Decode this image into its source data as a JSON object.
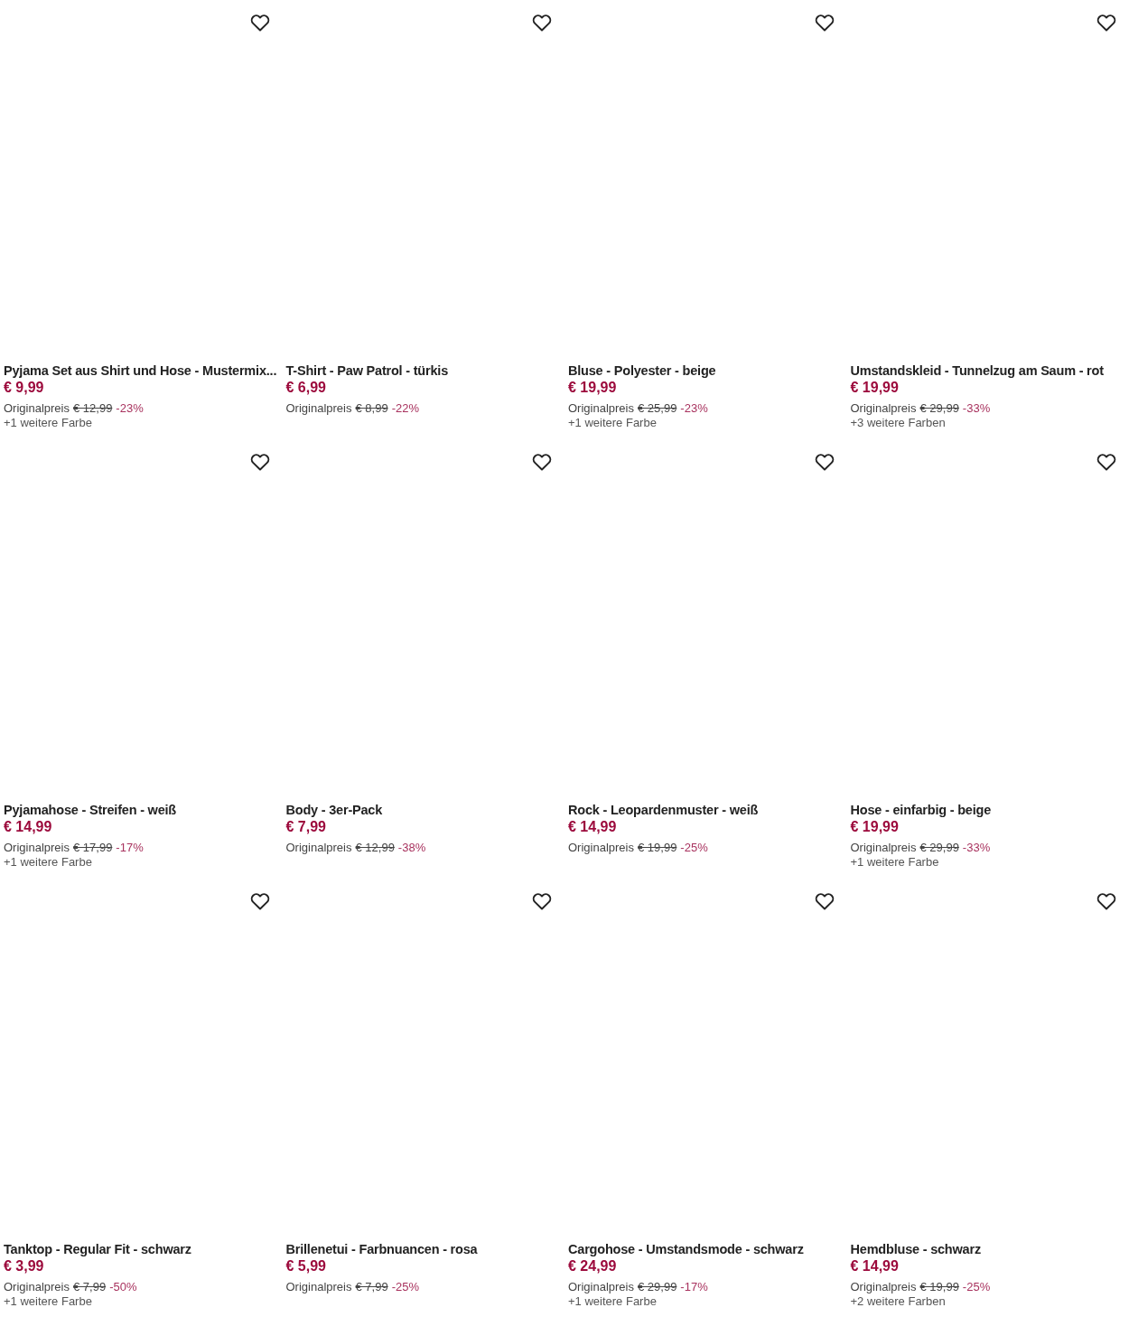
{
  "products": [
    {
      "name": "Pyjama Set aus Shirt und Hose - Mustermix...",
      "price": "€ 9,99",
      "original_label": "Originalpreis",
      "original_price": "€ 12,99",
      "discount": "-23%",
      "more_colors": "+1 weitere Farbe"
    },
    {
      "name": "T-Shirt - Paw Patrol - türkis",
      "price": "€ 6,99",
      "original_label": "Originalpreis",
      "original_price": "€ 8,99",
      "discount": "-22%"
    },
    {
      "name": "Bluse - Polyester - beige",
      "price": "€ 19,99",
      "original_label": "Originalpreis",
      "original_price": "€ 25,99",
      "discount": "-23%",
      "more_colors": "+1 weitere Farbe"
    },
    {
      "name": "Umstandskleid - Tunnelzug am Saum - rot",
      "price": "€ 19,99",
      "original_label": "Originalpreis",
      "original_price": "€ 29,99",
      "discount": "-33%",
      "more_colors": "+3 weitere Farben"
    },
    {
      "name": "Pyjamahose - Streifen - weiß",
      "price": "€ 14,99",
      "original_label": "Originalpreis",
      "original_price": "€ 17,99",
      "discount": "-17%",
      "more_colors": "+1 weitere Farbe"
    },
    {
      "name": "Body - 3er-Pack",
      "price": "€ 7,99",
      "original_label": "Originalpreis",
      "original_price": "€ 12,99",
      "discount": "-38%"
    },
    {
      "name": "Rock - Leopardenmuster - weiß",
      "price": "€ 14,99",
      "original_label": "Originalpreis",
      "original_price": "€ 19,99",
      "discount": "-25%"
    },
    {
      "name": "Hose - einfarbig - beige",
      "price": "€ 19,99",
      "original_label": "Originalpreis",
      "original_price": "€ 29,99",
      "discount": "-33%",
      "more_colors": "+1 weitere Farbe"
    },
    {
      "name": "Tanktop - Regular Fit - schwarz",
      "price": "€ 3,99",
      "original_label": "Originalpreis",
      "original_price": "€ 7,99",
      "discount": "-50%",
      "more_colors": "+1 weitere Farbe"
    },
    {
      "name": "Brillenetui - Farbnuancen - rosa",
      "price": "€ 5,99",
      "original_label": "Originalpreis",
      "original_price": "€ 7,99",
      "discount": "-25%"
    },
    {
      "name": "Cargohose - Umstandsmode - schwarz",
      "price": "€ 24,99",
      "original_label": "Originalpreis",
      "original_price": "€ 29,99",
      "discount": "-17%",
      "more_colors": "+1 weitere Farbe"
    },
    {
      "name": "Hemdbluse - schwarz",
      "price": "€ 14,99",
      "original_label": "Originalpreis",
      "original_price": "€ 19,99",
      "discount": "-25%",
      "more_colors": "+2 weitere Farben"
    }
  ]
}
